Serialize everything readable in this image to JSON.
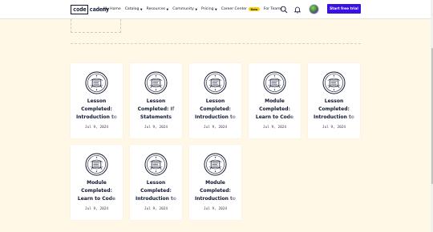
{
  "header": {
    "logo_boxed": "code",
    "logo_rest": "cademy",
    "nav": [
      {
        "label": "My Home",
        "caret": false
      },
      {
        "label": "Catalog",
        "caret": true
      },
      {
        "label": "Resources",
        "caret": true
      },
      {
        "label": "Community",
        "caret": true
      },
      {
        "label": "Pricing",
        "caret": true
      },
      {
        "label": "Career Center",
        "caret": false,
        "badge": "New"
      },
      {
        "label": "For Teams",
        "caret": false
      }
    ],
    "cta_label": "Start free trial"
  },
  "colors": {
    "background": "#fff8e6",
    "primary": "#3a10e5",
    "badge": "#ffd300",
    "text": "#10162f"
  },
  "achievements": [
    {
      "title": "Lesson\nCompleted:\nIntroduction to",
      "date": "Jul 9, 2024"
    },
    {
      "title": "Lesson\nCompleted: If\nStatements",
      "date": "Jul 9, 2024"
    },
    {
      "title": "Lesson\nCompleted:\nIntroduction to",
      "date": "Jul 9, 2024"
    },
    {
      "title": "Module\nCompleted:\nLearn to Code",
      "date": "Jul 9, 2024"
    },
    {
      "title": "Lesson\nCompleted:\nIntroduction to",
      "date": "Jul 9, 2024"
    },
    {
      "title": "Module\nCompleted:\nLearn to Code",
      "date": "Jul 9, 2024"
    },
    {
      "title": "Lesson\nCompleted:\nIntroduction to",
      "date": "Jul 9, 2024"
    },
    {
      "title": "Module\nCompleted:\nIntroduction to",
      "date": "Jul 9, 2024"
    }
  ]
}
